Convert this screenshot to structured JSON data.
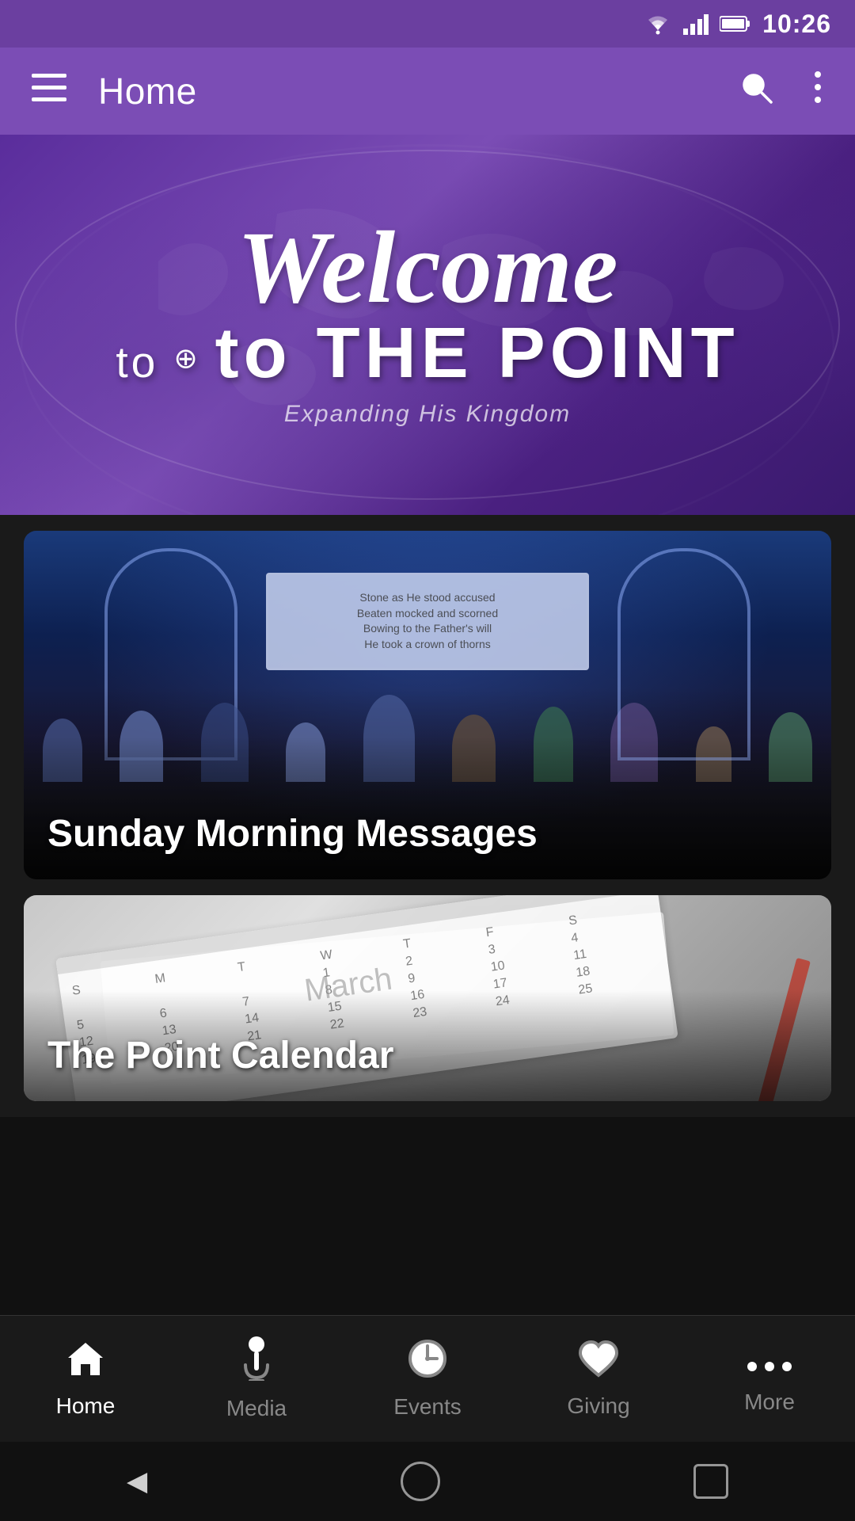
{
  "statusBar": {
    "time": "10:26"
  },
  "appBar": {
    "menuLabel": "≡",
    "title": "Home",
    "searchLabel": "🔍",
    "moreLabel": "⋮"
  },
  "heroBanner": {
    "welcomeLine1": "Welcome",
    "welcomeLine2": "to THE POINT",
    "subtitle": "Expanding His Kingdom"
  },
  "cards": [
    {
      "id": "sunday-messages",
      "label": "Sunday Morning Messages",
      "type": "church"
    },
    {
      "id": "point-calendar",
      "label": "The Point Calendar",
      "type": "calendar"
    }
  ],
  "bottomNav": {
    "items": [
      {
        "id": "home",
        "label": "Home",
        "icon": "🏠",
        "active": true
      },
      {
        "id": "media",
        "label": "Media",
        "icon": "🎙",
        "active": false
      },
      {
        "id": "events",
        "label": "Events",
        "icon": "🕐",
        "active": false
      },
      {
        "id": "giving",
        "label": "Giving",
        "icon": "♡",
        "active": false
      },
      {
        "id": "more",
        "label": "More",
        "icon": "···",
        "active": false
      }
    ]
  },
  "systemNav": {
    "back": "◀",
    "home": "⬤",
    "recent": "▪"
  }
}
